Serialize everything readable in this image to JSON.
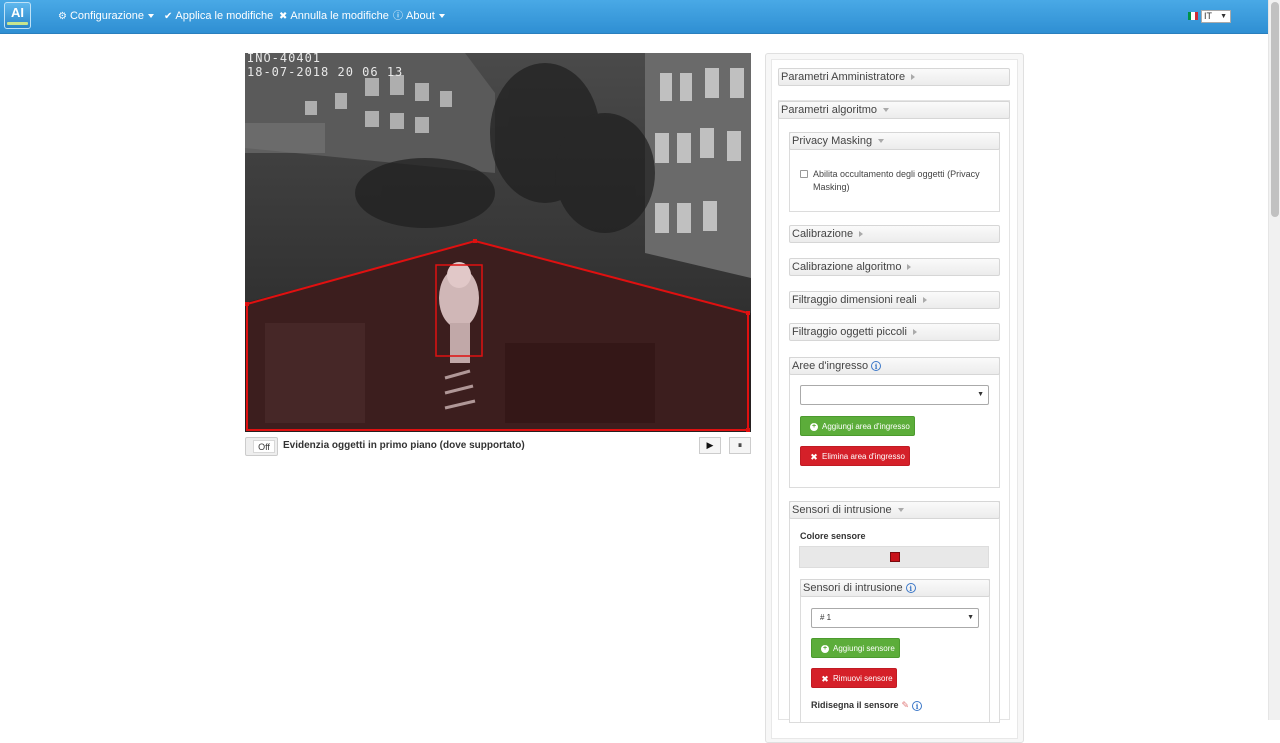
{
  "navbar": {
    "logo_text": "AI",
    "menu": [
      {
        "icon": "gear-icon",
        "label": "Configurazione",
        "has_caret": true
      },
      {
        "icon": "check-icon",
        "label": "Applica le modifiche",
        "has_caret": false
      },
      {
        "icon": "times-icon",
        "label": "Annulla le modifiche",
        "has_caret": false
      },
      {
        "icon": "info-circle-icon",
        "label": "About",
        "has_caret": true
      }
    ],
    "language": {
      "selected": "IT",
      "flag_colors": [
        "#009246",
        "#ffffff",
        "#ce2b37"
      ]
    }
  },
  "video": {
    "osd_line1": "INO-40401",
    "osd_line2": "18-07-2018 20 06 13",
    "overlay_color": "#e01010"
  },
  "video_controls": {
    "toggle_label": "Off",
    "highlight_label": "Evidenzia oggetti in primo piano (dove supportato)",
    "play_icon": "▶",
    "pause_icon": "⏸"
  },
  "panel": {
    "admin_params": "Parametri Amministratore",
    "algo_params": "Parametri algoritmo",
    "privacy": {
      "title": "Privacy Masking",
      "checkbox_label": "Abilita occultamento degli oggetti (Privacy Masking)",
      "checked": false
    },
    "calibrazione": "Calibrazione",
    "calibrazione_algo": "Calibrazione algoritmo",
    "filtro_dimensioni": "Filtraggio dimensioni reali",
    "filtro_piccoli": "Filtraggio oggetti piccoli",
    "aree": {
      "title": "Aree d'ingresso",
      "select_value": "",
      "add_button": "Aggiungi area d'ingresso",
      "delete_button": "Elimina area d'ingresso"
    },
    "sensori": {
      "title": "Sensori di intrusione",
      "color_label": "Colore sensore",
      "sensor_color": "#c8121a",
      "sub_title": "Sensori di intrusione",
      "select_value": "# 1",
      "add_button": "Aggiungi sensore",
      "remove_button": "Rimuovi sensore",
      "redraw_label": "Ridisegna il sensore"
    }
  }
}
